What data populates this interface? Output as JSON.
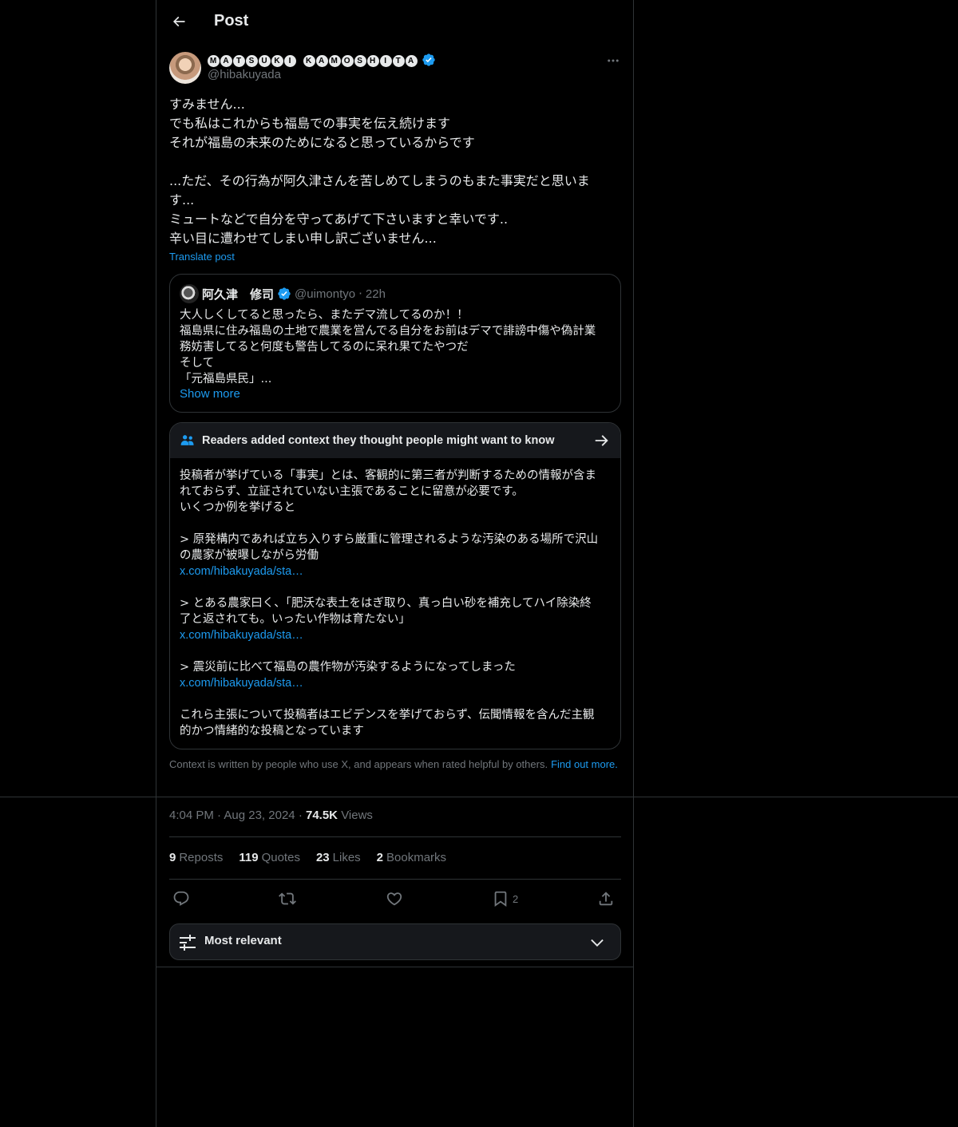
{
  "header": {
    "title": "Post",
    "back_icon": "arrow-left-icon"
  },
  "author": {
    "display_name_glyphs": [
      "M",
      "A",
      "T",
      "S",
      "U",
      "K",
      "I",
      " ",
      "K",
      "A",
      "M",
      "O",
      "S",
      "H",
      "I",
      "T",
      "A"
    ],
    "handle": "@hibakuyada",
    "verified": true
  },
  "post": {
    "text": "すみません...\nでも私はこれからも福島での事実を伝え続けます\nそれが福島の未来のためになると思っているからです\n\n...ただ、その行為が阿久津さんを苦しめてしまうのもまた事実だと思いま\nす...\nミュートなどで自分を守ってあげて下さいますと幸いです..\n辛い目に遭わせてしまい申し訳ございません...",
    "translate_label": "Translate post"
  },
  "quote": {
    "name": "阿久津　修司",
    "handle": "@uimontyo",
    "dot": "·",
    "time": "22h",
    "text": "大人しくしてると思ったら、またデマ流してるのか！！\n福島県に住み福島の土地で農業を営んでる自分をお前はデマで誹謗中傷や偽計業\n務妨害してると何度も警告してるのに呆れ果てたやつだ\nそして\n「元福島県民」...",
    "show_more": "Show more"
  },
  "note": {
    "title": "Readers added context they thought people might want to know",
    "para1": "投稿者が挙げている「事実」とは、客観的に第三者が判断するための情報が含ま\nれておらず、立証されていない主張であることに留意が必要です。\nいくつか例を挙げると",
    "para2": "> 原発構内であれば立ち入りすら厳重に管理されるような汚染のある場所で沢山\nの農家が被曝しながら労働",
    "link1": "x.com/hibakuyada/sta…",
    "para3": "> とある農家曰く、「肥沃な表土をはぎ取り、真っ白い砂を補充してハイ除染終\n了と返されても。いったい作物は育たない」",
    "link2": "x.com/hibakuyada/sta…",
    "para4": "> 震災前に比べて福島の農作物が汚染するようになってしまった",
    "link3": "x.com/hibakuyada/sta…",
    "para5": "これら主張について投稿者はエビデンスを挙げておらず、伝聞情報を含んだ主観\n的かつ情緒的な投稿となっています",
    "disclaimer": "Context is written by people who use X, and appears when rated helpful by others.",
    "find_out": "Find out more."
  },
  "meta": {
    "time": "4:04 PM",
    "sep": "·",
    "date": "Aug 23, 2024",
    "views_count": "74.5K",
    "views_label": "Views"
  },
  "stats": {
    "reposts_count": "9",
    "reposts_label": "Reposts",
    "quotes_count": "119",
    "quotes_label": "Quotes",
    "likes_count": "23",
    "likes_label": "Likes",
    "bookmarks_count": "2",
    "bookmarks_label": "Bookmarks"
  },
  "actions": {
    "bookmark_count": "2"
  },
  "sort": {
    "label": "Most relevant"
  },
  "colors": {
    "background": "#000000",
    "text": "#e7e9ea",
    "muted": "#71767b",
    "accent": "#1d9bf0",
    "border": "#2f3336"
  }
}
